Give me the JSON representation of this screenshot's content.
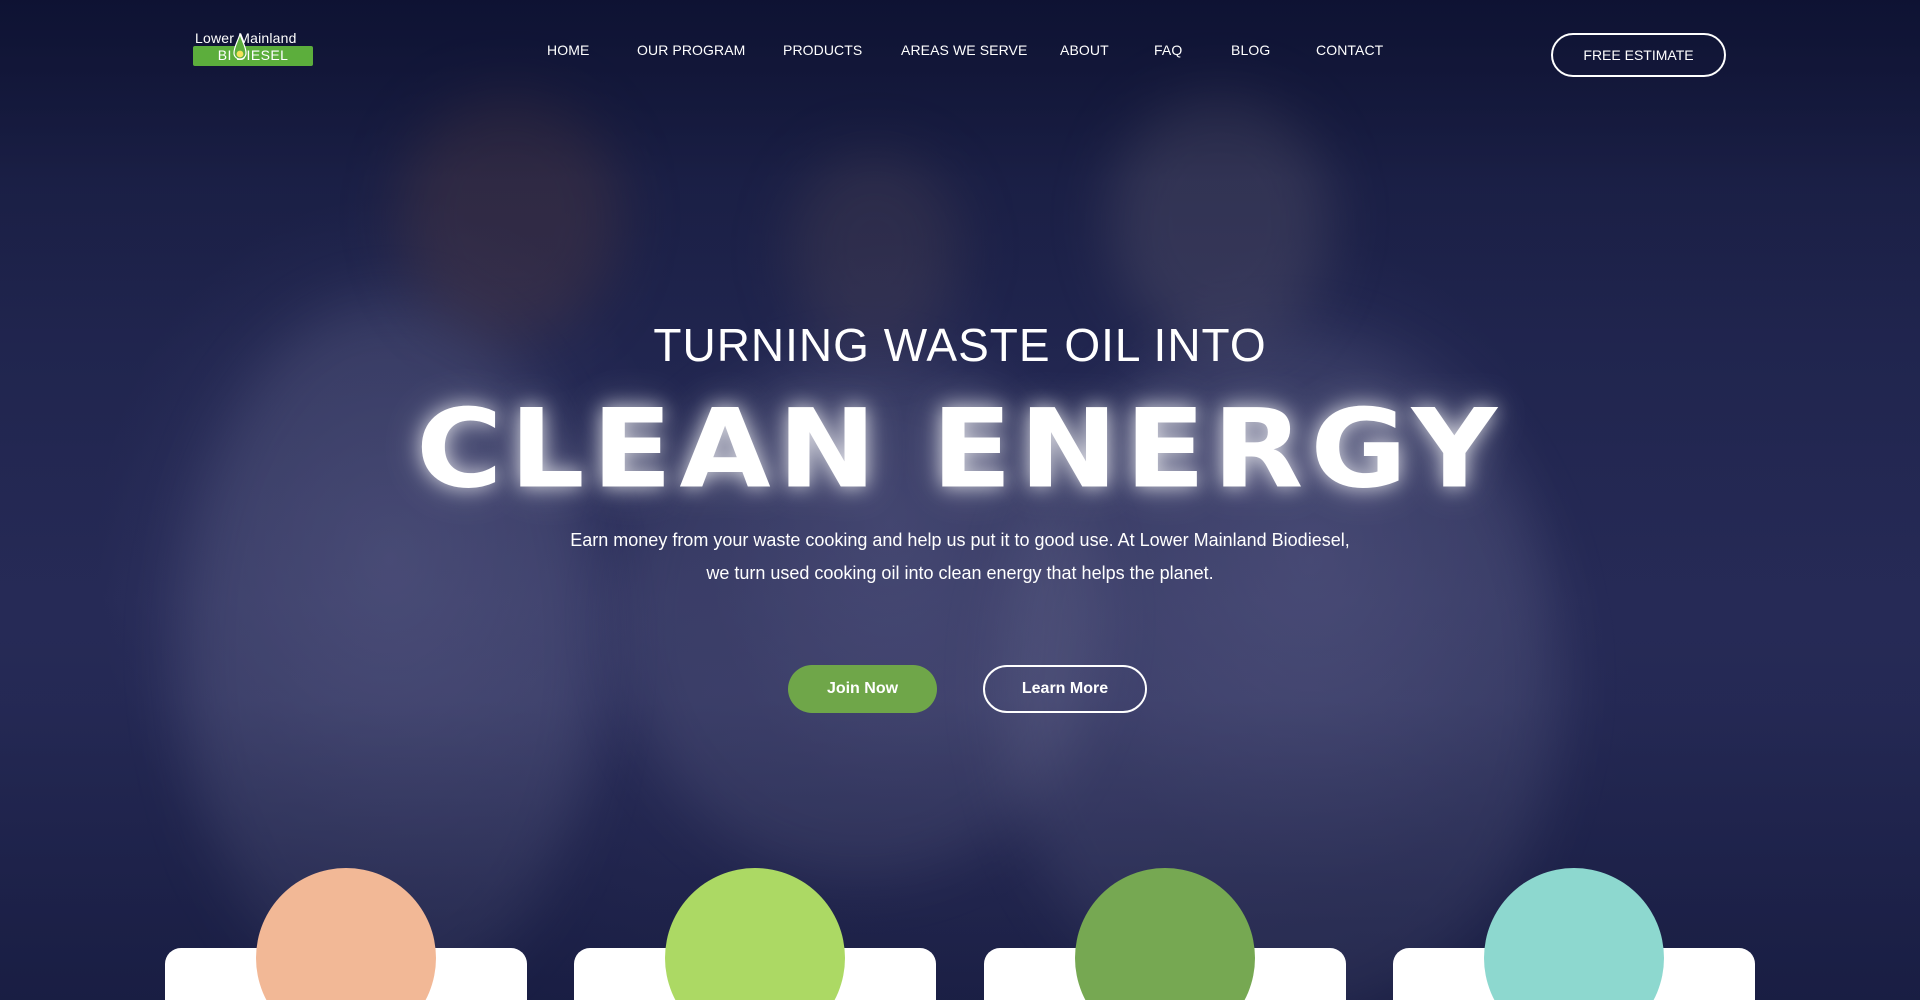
{
  "logo": {
    "top_text": "Lower Mainland",
    "bottom_text": "BI  DIESEL",
    "band_color": "#5cae3c"
  },
  "nav": {
    "items": [
      {
        "label": "HOME"
      },
      {
        "label": "OUR PROGRAM"
      },
      {
        "label": "PRODUCTS"
      },
      {
        "label": "AREAS WE SERVE"
      },
      {
        "label": "ABOUT"
      },
      {
        "label": "FAQ"
      },
      {
        "label": "BLOG"
      },
      {
        "label": "CONTACT"
      }
    ],
    "cta_label": "FREE ESTIMATE"
  },
  "hero": {
    "kicker": "TURNING WASTE OIL INTO",
    "headline": "CLEAN ENERGY",
    "subtext": "Earn money from your waste cooking and help us put it to good use. At Lower Mainland Biodiesel, we turn used cooking oil into clean energy that helps the planet.",
    "primary_button": "Join Now",
    "secondary_button": "Learn More"
  },
  "colors": {
    "background": "#1b2147",
    "accent_green": "#6fa649",
    "text": "#ffffff"
  },
  "feature_cards": [
    {
      "circle_color": "#f2b896"
    },
    {
      "circle_color": "#acd964"
    },
    {
      "circle_color": "#76a852"
    },
    {
      "circle_color": "#8dd8cf"
    }
  ]
}
